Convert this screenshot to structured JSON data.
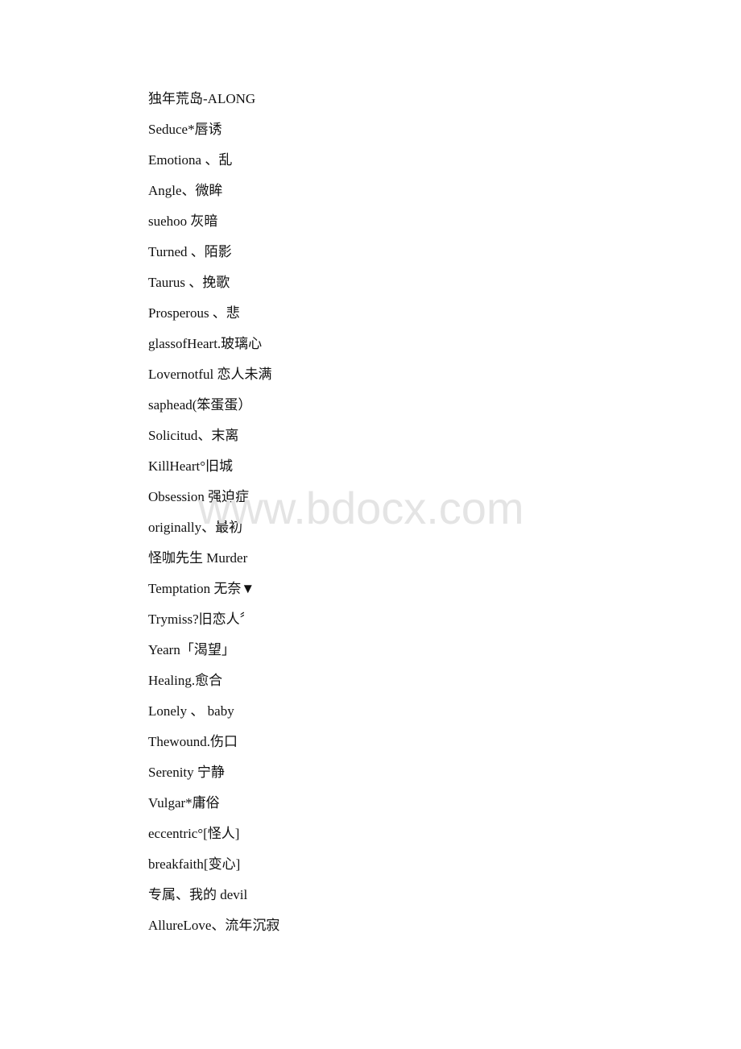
{
  "document": {
    "lines": [
      "独年荒岛-ALONG",
      "Seduce*唇诱",
      "Emotiona 、乱",
      "Angle、微眸",
      "suehoo 灰暗",
      "Turned 、陌影",
      "Taurus 、挽歌",
      "Prosperous 、悲",
      "glassofHeart.玻璃心",
      "Lovernotful 恋人未满",
      "saphead(笨蛋蛋）",
      "Solicitud、末离",
      "KillHeart°旧城",
      "Obsession 强迫症",
      "originally、最初",
      "怪咖先生 Murder",
      "Temptation 无奈▼",
      "Trymiss?旧恋人〞",
      "Yearn「渴望」",
      "Healing.愈合",
      "Lonely 、 baby",
      "Thewound.伤口",
      "Serenity 宁静",
      "Vulgar*庸俗",
      "eccentric°[怪人]",
      "breakfaith[变心]",
      "专属、我的 devil",
      "AllureLove、流年沉寂"
    ]
  },
  "watermark": {
    "text": "www.bdocx.com",
    "color": "#e4e4e4"
  }
}
